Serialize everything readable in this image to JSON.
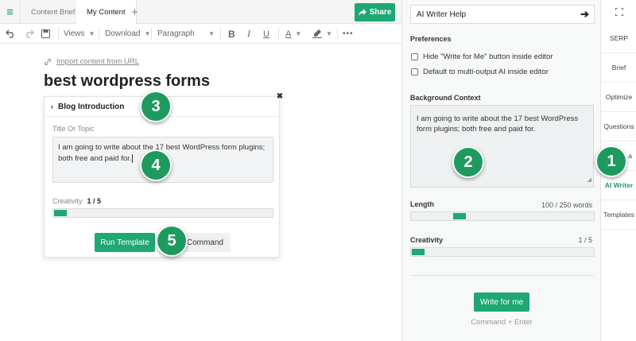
{
  "tabs": {
    "menu_icon": "hamburger-icon",
    "items": [
      "Content Brief",
      "My Content"
    ],
    "add_label": "+",
    "share_label": "Share"
  },
  "toolbar": {
    "views": "Views",
    "download": "Download",
    "paragraph": "Paragraph",
    "bold": "B",
    "italic": "I",
    "underline": "U",
    "font_color": "A",
    "more": "•••"
  },
  "editor": {
    "import_link": "Import content from URL",
    "title": "best wordpress forms"
  },
  "card": {
    "header": "Blog Introduction",
    "topic_label": "Title Or Topic",
    "topic_value": "I am going to write about the 17 best WordPress form plugins; both free and paid for.",
    "creativity_label": "Creativity",
    "creativity_value": "1 / 5",
    "creativity_level": 0.2,
    "run_label": "Run Template",
    "command_label": "Command",
    "close_icon": "close-icon"
  },
  "panel": {
    "help_label": "AI Writer Help",
    "preferences_title": "Preferences",
    "pref_1": "Hide \"Write for Me\" button inside editor",
    "pref_2": "Default to multi-output AI inside editor",
    "context_title": "Background Context",
    "context_value": "I am going to write about the 17 best WordPress form plugins; both free and paid for.",
    "length_label": "Length",
    "length_value": "100 / 250 words",
    "length_level": 0.4,
    "creativity_label": "Creativity",
    "creativity_value": "1 / 5",
    "creativity_level": 0.2,
    "write_label": "Write for me",
    "hint": "Command + Enter"
  },
  "rail": {
    "expand_icon": "expand-icon",
    "items": [
      "SERP",
      "Brief",
      "Optimize",
      "Questions",
      "Data",
      "AI Writer",
      "Templates"
    ],
    "data_visible": "a"
  },
  "markers": [
    "1",
    "2",
    "3",
    "4",
    "5"
  ],
  "colors": {
    "accent": "#1fa774",
    "marker": "#1f9a5f"
  }
}
